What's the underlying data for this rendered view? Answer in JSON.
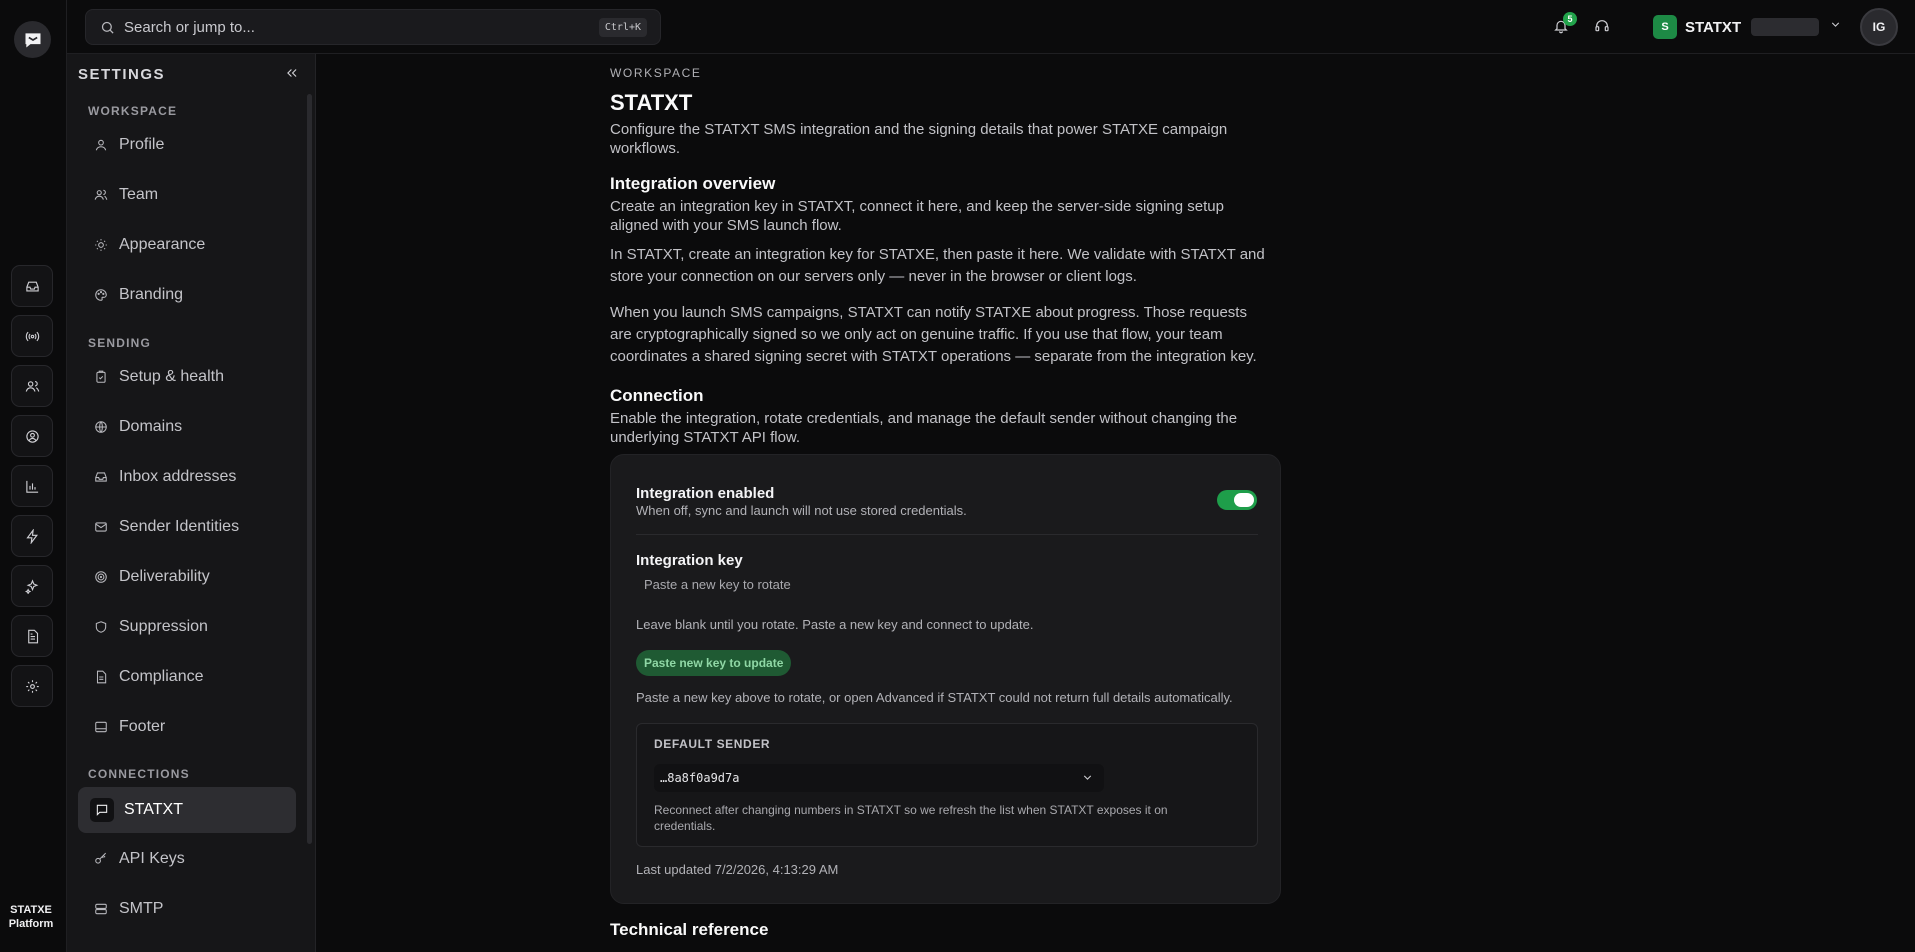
{
  "topbar": {
    "search_placeholder": "Search or jump to...",
    "search_shortcut": "Ctrl+K",
    "notification_count": "5",
    "workspace_initial": "S",
    "workspace_name": "STATXT",
    "user_initials": "IG"
  },
  "rail": {
    "brand_line1": "STATXE",
    "brand_line2": "Platform",
    "icons": [
      "inbox-icon",
      "broadcast-icon",
      "contacts-icon",
      "account-icon",
      "analytics-icon",
      "automation-icon",
      "ai-icon",
      "documents-icon",
      "settings-icon"
    ]
  },
  "sidebar": {
    "title": "SETTINGS",
    "sections": {
      "workspace": "WORKSPACE",
      "sending": "SENDING",
      "connections": "CONNECTIONS"
    },
    "items": [
      {
        "label": "Profile",
        "icon": "user-icon"
      },
      {
        "label": "Team",
        "icon": "team-icon"
      },
      {
        "label": "Appearance",
        "icon": "sun-icon"
      },
      {
        "label": "Branding",
        "icon": "palette-icon"
      },
      {
        "label": "Setup & health",
        "icon": "clipboard-icon"
      },
      {
        "label": "Domains",
        "icon": "globe-icon"
      },
      {
        "label": "Inbox addresses",
        "icon": "inbox-icon"
      },
      {
        "label": "Sender Identities",
        "icon": "mail-icon"
      },
      {
        "label": "Deliverability",
        "icon": "target-icon"
      },
      {
        "label": "Suppression",
        "icon": "shield-icon"
      },
      {
        "label": "Compliance",
        "icon": "document-icon"
      },
      {
        "label": "Footer",
        "icon": "footer-icon"
      },
      {
        "label": "STATXT",
        "icon": "message-icon",
        "active": true
      },
      {
        "label": "API Keys",
        "icon": "key-icon"
      },
      {
        "label": "SMTP",
        "icon": "server-icon"
      }
    ]
  },
  "main": {
    "eyebrow": "WORKSPACE",
    "title": "STATXT",
    "intro": "Configure the STATXT SMS integration and the signing details that power STATXE campaign workflows.",
    "overview": {
      "heading": "Integration overview",
      "lead": "Create an integration key in STATXT, connect it here, and keep the server-side signing setup aligned with your SMS launch flow.",
      "p1": "In STATXT, create an integration key for STATXE, then paste it here. We validate with STATXT and store your connection on our servers only — never in the browser or client logs.",
      "p2": "When you launch SMS campaigns, STATXT can notify STATXE about progress. Those requests are cryptographically signed so we only act on genuine traffic. If you use that flow, your team coordinates a shared signing secret with STATXT operations — separate from the integration key."
    },
    "connection": {
      "heading": "Connection",
      "lead": "Enable the integration, rotate credentials, and manage the default sender without changing the underlying STATXT API flow.",
      "enabled_title": "Integration enabled",
      "enabled_sub": "When off, sync and launch will not use stored credentials.",
      "enabled": true,
      "key_title": "Integration key",
      "key_placeholder": "Paste a new key to rotate",
      "key_help": "Leave blank until you rotate. Paste a new key and connect to update.",
      "key_button": "Paste new key to update",
      "key_note": "Paste a new key above to rotate, or open Advanced if STATXT could not return full details automatically.",
      "default_sender_label": "DEFAULT SENDER",
      "default_sender_value": "…8a8f0a9d7a",
      "default_sender_help": "Reconnect after changing numbers in STATXT so we refresh the list when STATXT exposes it on credentials.",
      "last_updated": "Last updated 7/2/2026, 4:13:29 AM"
    },
    "technical": {
      "heading": "Technical reference"
    }
  },
  "colors": {
    "accent": "#1e9e4a",
    "background": "#0b0b0c",
    "sidebar": "#161618",
    "card": "#1a1a1c"
  }
}
